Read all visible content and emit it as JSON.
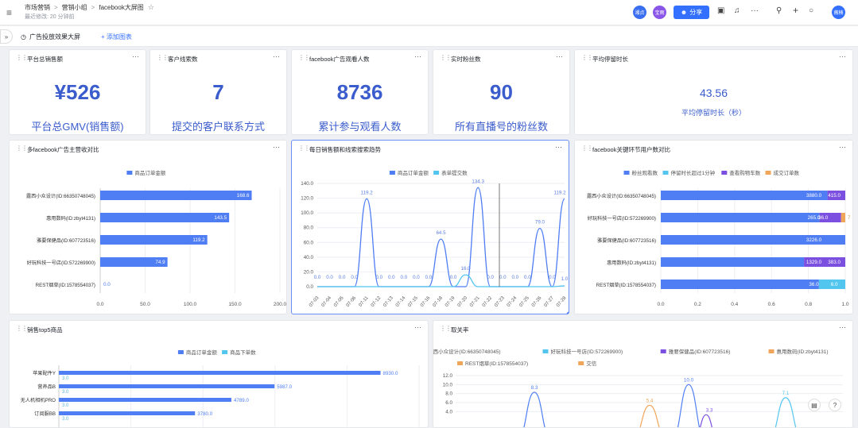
{
  "breadcrumb": {
    "a": "市场营销",
    "b": "营销小组",
    "c": "facebook大屏图"
  },
  "last_edit": "最近修改: 20 分钟前",
  "users": [
    "湘贞",
    "宝雨"
  ],
  "share_label": "分享",
  "user_me": "薇楠",
  "tab_label": "广告投放效果大屏",
  "add_chart": "添加图表",
  "kpis": [
    {
      "title": "平台总销售额",
      "value": "¥526",
      "caption": "平台总GMV(销售额)"
    },
    {
      "title": "客户线索数",
      "value": "7",
      "caption": "提交的客户联系方式"
    },
    {
      "title": "facebook广告观看人数",
      "value": "8736",
      "caption": "累计参与观看人数"
    },
    {
      "title": "实时粉丝数",
      "value": "90",
      "caption": "所有直播号的粉丝数"
    },
    {
      "title": "平均停留时长",
      "value": "43.56",
      "caption": "平均停留时长（秒）"
    }
  ],
  "colors": {
    "blue": "#4f7df3",
    "cyan": "#53c6f0",
    "purple": "#7b4fe0",
    "orange": "#f0a65a",
    "slate": "#3a5ccc"
  },
  "chart_data": [
    {
      "type": "bar",
      "title": "多facebook广告主营收对比",
      "legend": [
        "商品订单金额"
      ],
      "categories": [
        "露西小众设计(ID:66350748045)",
        "惠用数码(ID:zbyt4131)",
        "雅要保健品(ID:607723516)",
        "好玩科技一号店(ID:572269900)",
        "REST烟草(ID:1578554037)"
      ],
      "values": [
        168.6,
        143.5,
        119.2,
        74.9,
        0.0
      ],
      "xlim": [
        0,
        200
      ],
      "xticks": [
        "0.0",
        "50.0",
        "100.0",
        "150.0",
        "200.0"
      ]
    },
    {
      "type": "line",
      "title": "每日销售额和线索搜索趋势",
      "legend": [
        "商品订单金额",
        "表单提交数"
      ],
      "x": [
        "07-03",
        "07-04",
        "07-05",
        "07-06",
        "07-11",
        "07-12",
        "07-13",
        "07-14",
        "07-15",
        "07-16",
        "07-18",
        "07-19",
        "07-20",
        "07-21",
        "07-22",
        "07-23",
        "07-24",
        "07-25",
        "07-26",
        "07-27",
        "07-28"
      ],
      "series": [
        {
          "name": "商品订单金额",
          "values": [
            0.0,
            0.0,
            0.0,
            0.0,
            119.2,
            0.0,
            0.0,
            0.0,
            0.0,
            0.0,
            64.5,
            0.0,
            0.0,
            134.3,
            0.0,
            0.0,
            0.0,
            0.0,
            79.0,
            0.0,
            119.2
          ]
        },
        {
          "name": "表单提交数",
          "values": [
            0,
            0,
            0,
            0,
            0,
            0,
            0,
            0,
            0,
            0,
            0,
            0,
            16.0,
            0,
            0,
            0,
            0,
            0,
            0,
            0,
            1.0
          ]
        }
      ],
      "ylim": [
        0,
        140
      ],
      "yticks": [
        "0.0",
        "20.0",
        "40.0",
        "60.0",
        "80.0",
        "100.0",
        "120.0",
        "140.0"
      ],
      "point_labels": [
        {
          "i": 0,
          "t": "0.0"
        },
        {
          "i": 1,
          "t": "0.0"
        },
        {
          "i": 2,
          "t": "0.0"
        },
        {
          "i": 3,
          "t": "0.0"
        },
        {
          "i": 4,
          "t": "119.2"
        },
        {
          "i": 5,
          "t": "0.0"
        },
        {
          "i": 6,
          "t": "0.0"
        },
        {
          "i": 7,
          "t": "0.0"
        },
        {
          "i": 8,
          "t": "0.0"
        },
        {
          "i": 9,
          "t": "0.0"
        },
        {
          "i": 10,
          "t": "64.5"
        },
        {
          "i": 11,
          "t": "0.0"
        },
        {
          "i": 12,
          "t": "16.0"
        },
        {
          "i": 13,
          "t": "134.3"
        },
        {
          "i": 14,
          "t": "0.0"
        },
        {
          "i": 15,
          "t": "0.0"
        },
        {
          "i": 16,
          "t": "0.0"
        },
        {
          "i": 17,
          "t": "0.0"
        },
        {
          "i": 18,
          "t": "79.0"
        },
        {
          "i": 19,
          "t": "0.0"
        },
        {
          "i": 20,
          "t": "119.2"
        },
        {
          "i": 20,
          "t": "1.0"
        }
      ]
    },
    {
      "type": "bar",
      "title": "facebook关键环节用户数对比",
      "legend": [
        "粉丝观看数",
        "停留时长超过1分钟",
        "查看购物车数",
        "成交订单数"
      ],
      "categories": [
        "露西小众设计(ID:66350748045)",
        "好玩科技一号店(ID:572269900)",
        "雅要保健品(ID:607723516)",
        "惠用数码(ID:zbyt4131)",
        "REST烟草(ID:1578554037)"
      ],
      "series": [
        {
          "name": "粉丝观看数",
          "values": [
            3880.0,
            265.0,
            3226.0,
            1329.0,
            36.0
          ]
        },
        {
          "name": "停留时长超过1分钟",
          "values": [
            0,
            0,
            0,
            0,
            6.0
          ]
        },
        {
          "name": "查看购物车数",
          "values": [
            415.0,
            36.0,
            0,
            383.0,
            0
          ]
        },
        {
          "name": "成交订单数",
          "values": [
            0,
            7,
            0,
            0,
            0
          ]
        }
      ],
      "segment_labels": [
        [
          "3880.0",
          "415.0"
        ],
        [
          "265.0",
          "36.0",
          "7"
        ],
        [
          "3226.0"
        ],
        [
          "1329.0",
          "383.0"
        ],
        [
          "36.0",
          "6.0"
        ]
      ],
      "xticks": [
        "0.0",
        "0.2",
        "0.4",
        "0.6",
        "0.8",
        "1.0"
      ]
    },
    {
      "type": "bar",
      "title": "销售top5商品",
      "legend": [
        "商品订单金额",
        "商品下单数"
      ],
      "categories": [
        "苹果配件Y",
        "营养品B",
        "无人机相机PRO",
        "订阅服BB"
      ],
      "series": [
        {
          "name": "商品订单金额",
          "values": [
            8930.0,
            5987.0,
            4789.0,
            3780.0
          ]
        },
        {
          "name": "商品下单数",
          "values": [
            3.0,
            3.0,
            3.0,
            3.0
          ]
        }
      ],
      "xlim": [
        0,
        10000
      ]
    },
    {
      "type": "line",
      "title": "取关率",
      "legend": [
        "露西小众设计(ID:66350748045)",
        "好玩科技一号店(ID:572269900)",
        "雅要保健品(ID:607723516)",
        "惠用数码(ID:zbyt4131)",
        "REST烟草(ID:1578554037)",
        "交信"
      ],
      "yticks": [
        "4.0",
        "6.0",
        "8.0",
        "10.0",
        "12.0"
      ],
      "ylim": [
        0,
        12
      ],
      "peaks": [
        {
          "series": "露西小众设计(ID:66350748045)",
          "value": 8.3
        },
        {
          "series": "惠用数码(ID:zbyt4131)",
          "value": 5.4
        },
        {
          "series": "露西小众设计(ID:66350748045)",
          "value": 10.0
        },
        {
          "series": "雅要保健品(ID:607723516)",
          "value": 3.3
        },
        {
          "series": "好玩科技一号店(ID:572269900)",
          "value": 7.1
        }
      ]
    }
  ]
}
